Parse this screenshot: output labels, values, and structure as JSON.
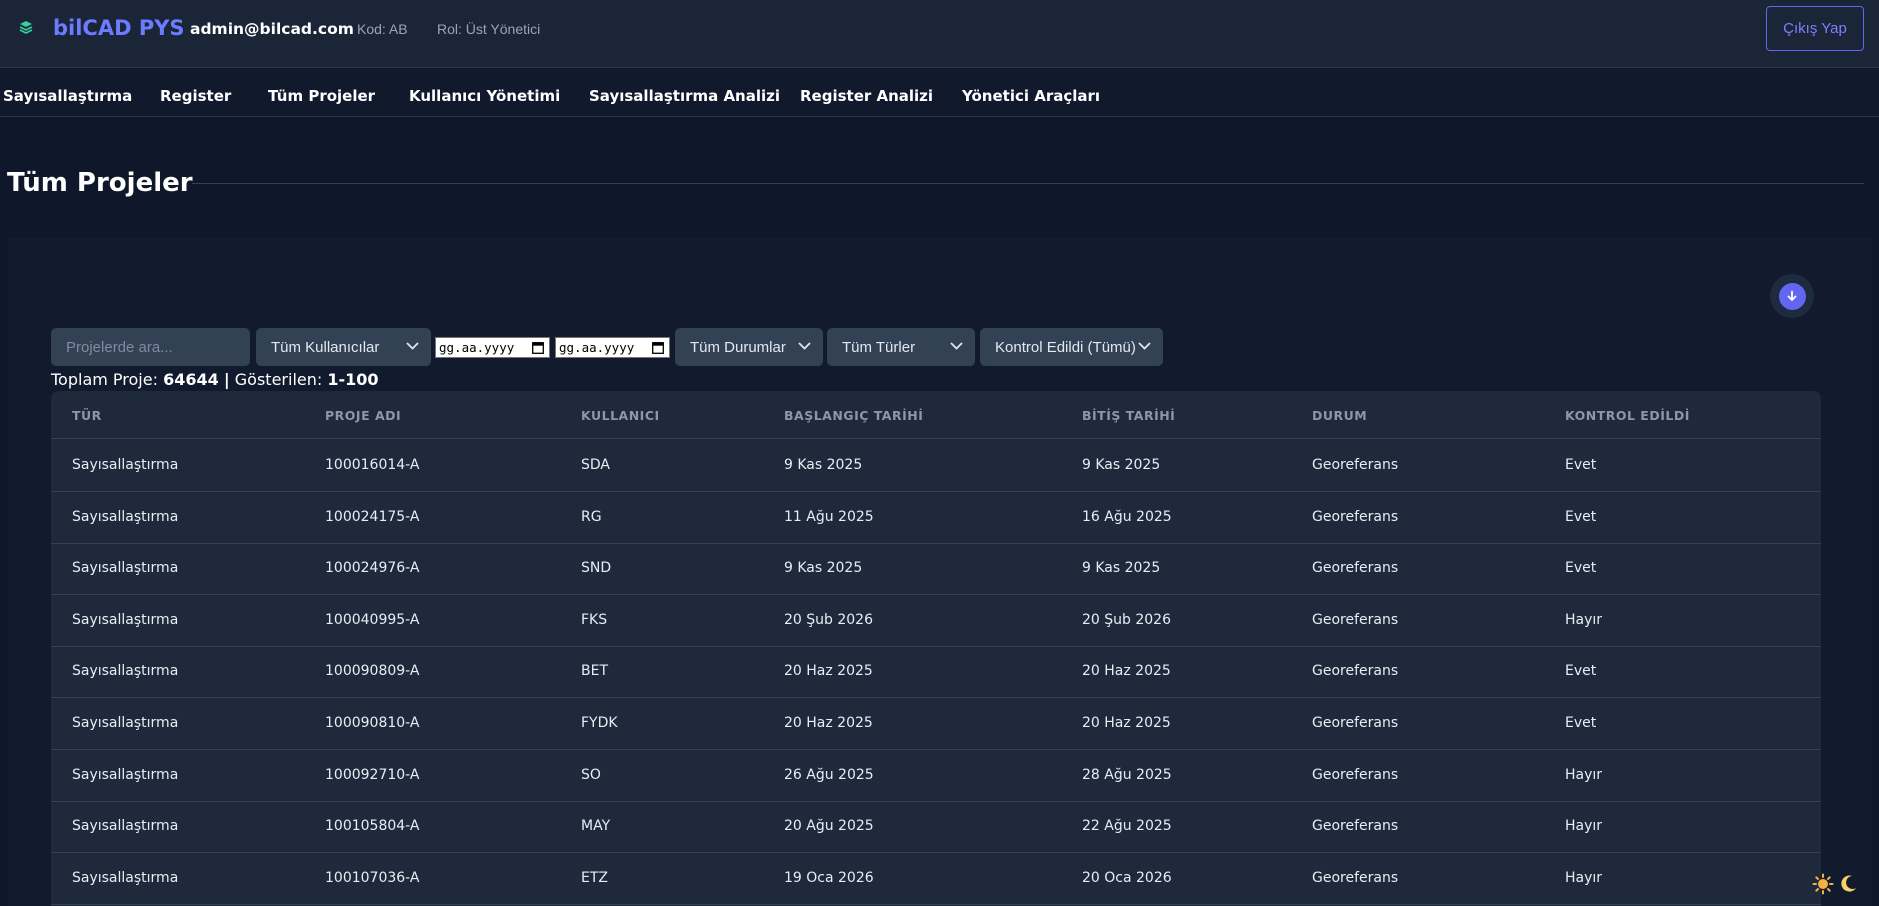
{
  "header": {
    "brand": "bilCAD PYS",
    "user_email": "admin@bilcad.com",
    "code": "Kod: AB",
    "role": "Rol: Üst Yönetici",
    "logout_label": "Çıkış Yap"
  },
  "nav": {
    "items": [
      "Sayısallaştırma",
      "Register",
      "Tüm Projeler",
      "Kullanıcı Yönetimi",
      "Sayısallaştırma Analizi",
      "Register Analizi",
      "Yönetici Araçları"
    ]
  },
  "page": {
    "title": "Tüm Projeler"
  },
  "filters": {
    "search_placeholder": "Projelerde ara...",
    "users": "Tüm Kullanıcılar",
    "date_start": "gg.aa.yyyy",
    "date_end": "gg.aa.yyyy",
    "statuses": "Tüm Durumlar",
    "types": "Tüm Türler",
    "checked": "Kontrol Edildi (Tümü)"
  },
  "summary": {
    "total_label": "Toplam Proje:",
    "total_value": "64644",
    "separator": "|",
    "shown_label": "Gösterilen:",
    "shown_value": "1-100"
  },
  "table": {
    "columns": [
      "TÜR",
      "PROJE ADI",
      "KULLANICI",
      "BAŞLANGIÇ TARİHİ",
      "BİTİŞ TARİHİ",
      "DURUM",
      "KONTROL EDİLDİ"
    ],
    "rows": [
      [
        "Sayısallaştırma",
        "100016014-A",
        "SDA",
        "9 Kas 2025",
        "9 Kas 2025",
        "Georeferans",
        "Evet"
      ],
      [
        "Sayısallaştırma",
        "100024175-A",
        "RG",
        "11 Ağu 2025",
        "16 Ağu 2025",
        "Georeferans",
        "Evet"
      ],
      [
        "Sayısallaştırma",
        "100024976-A",
        "SND",
        "9 Kas 2025",
        "9 Kas 2025",
        "Georeferans",
        "Evet"
      ],
      [
        "Sayısallaştırma",
        "100040995-A",
        "FKS",
        "20 Şub 2026",
        "20 Şub 2026",
        "Georeferans",
        "Hayır"
      ],
      [
        "Sayısallaştırma",
        "100090809-A",
        "BET",
        "20 Haz 2025",
        "20 Haz 2025",
        "Georeferans",
        "Evet"
      ],
      [
        "Sayısallaştırma",
        "100090810-A",
        "FYDK",
        "20 Haz 2025",
        "20 Haz 2025",
        "Georeferans",
        "Evet"
      ],
      [
        "Sayısallaştırma",
        "100092710-A",
        "SO",
        "26 Ağu 2025",
        "28 Ağu 2025",
        "Georeferans",
        "Hayır"
      ],
      [
        "Sayısallaştırma",
        "100105804-A",
        "MAY",
        "20 Ağu 2025",
        "22 Ağu 2025",
        "Georeferans",
        "Hayır"
      ],
      [
        "Sayısallaştırma",
        "100107036-A",
        "ETZ",
        "19 Oca 2026",
        "20 Oca 2026",
        "Georeferans",
        "Hayır"
      ]
    ]
  },
  "icons": {
    "logo": "layers-icon",
    "scroll_down": "arrow-down-icon",
    "sun": "sun-icon",
    "moon": "moon-icon"
  },
  "colors": {
    "accent": "#6366f1",
    "background": "#0f172a",
    "header": "#1b2538",
    "table": "#1e293b"
  }
}
